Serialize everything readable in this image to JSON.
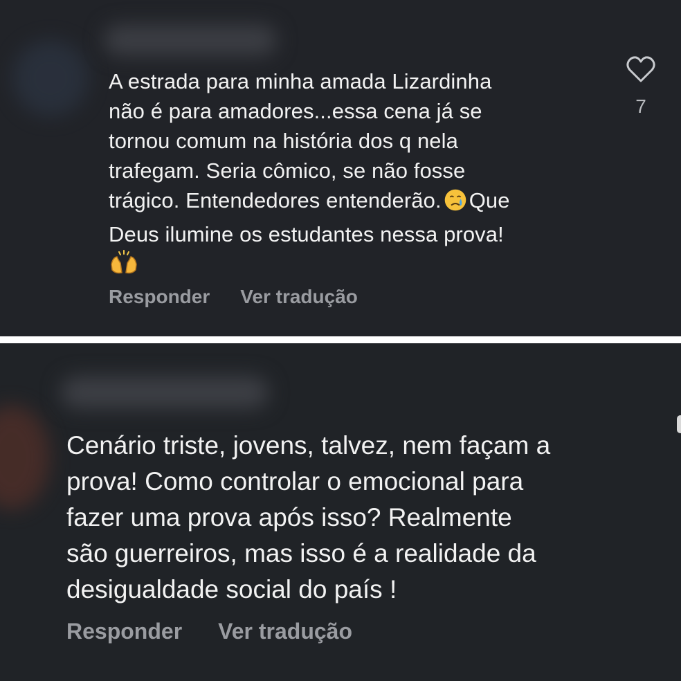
{
  "comments": [
    {
      "text_before_emoji": "A estrada para minha amada Lizardinha\nnão é para amadores...essa cena já se\ntornou comum na história dos q nela\ntrafegam. Seria cômico, se não fosse\ntrágico. Entendedores entenderão.",
      "emoji_1": "crying-face",
      "text_after_emoji": "Que\nDeus ilumine os estudantes nessa prova!\n",
      "emoji_2": "raising-hands",
      "reply_label": "Responder",
      "translate_label": "Ver tradução",
      "like_count": "7"
    },
    {
      "text": "Cenário triste, jovens, talvez, nem façam a\nprova!  Como controlar o emocional para\nfazer uma prova após isso? Realmente\nsão guerreiros, mas isso é a realidade da\ndesigualdade social do país !",
      "reply_label": "Responder",
      "translate_label": "Ver tradução"
    }
  ],
  "colors": {
    "background": "#212328",
    "text": "#f2f2f2",
    "muted_text": "#9a9ca1",
    "separator": "#ffffff"
  }
}
